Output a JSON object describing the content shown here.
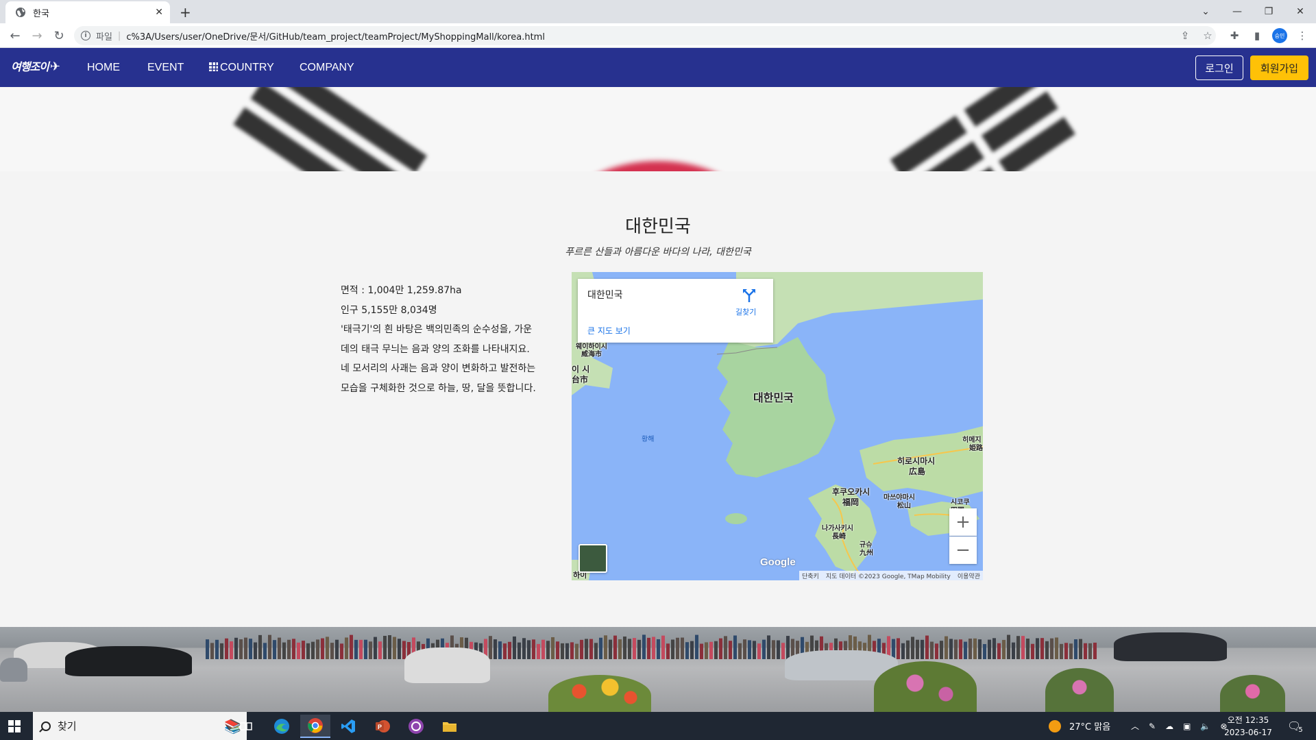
{
  "browser": {
    "tab_title": "한국",
    "address_scheme": "파일",
    "address_url": "c%3A/Users/user/OneDrive/문서/GitHub/team_project/teamProject/MyShoppingMall/korea.html",
    "profile_initials": "승민"
  },
  "nav": {
    "logo": "여행조이",
    "links": [
      "HOME",
      "EVENT",
      "COUNTRY",
      "COMPANY"
    ],
    "login": "로그인",
    "signup": "회원가입"
  },
  "content": {
    "title": "대한민국",
    "subtitle": "푸르른 산들과 아름다운 바다의 나라, 대한민국",
    "area": "면적 : 1,004만 1,259.87ha",
    "population": "인구 5,155만 8,034명",
    "description_lines": [
      "'태극기'의 흰 바탕은 백의민족의 순수성을, 가운",
      "데의 태극 무늬는 음과 양의 조화를 나타내지요.",
      "네 모서리의 사괘는 음과 양이 변화하고 발전하는",
      "모습을 구체화한 것으로 하늘, 땅, 달을 뜻합니다."
    ]
  },
  "map": {
    "place_name": "대한민국",
    "directions": "길찾기",
    "larger_map": "큰 지도 보기",
    "labels": {
      "korea": "대한민국",
      "yellow_sea": "황해",
      "hiroshima": "히로시마시",
      "hiroshima_kanji": "広島",
      "fukuoka": "후쿠오카시",
      "fukuoka_kanji": "福岡",
      "matsuyama": "마쓰야마시",
      "matsuyama_kanji": "松山",
      "nagasaki": "나가사키시",
      "nagasaki_kanji": "長崎",
      "kyushu": "규슈",
      "kyushu_kanji": "九州",
      "weihai": "웨이하이시",
      "weihai_kanji": "威海市",
      "taian": "이 시",
      "taian_kanji": "台市",
      "shikoku": "시코쿠",
      "shikoku_kanji": "四国",
      "himeji": "히메지",
      "himeji_kanji": "姫路",
      "bottom_left": "하이"
    },
    "zoom_in": "+",
    "zoom_out": "−",
    "google": "Google",
    "attrib_shortcuts": "단축키",
    "attrib_data": "지도 데이터 ©2023 Google, TMap Mobility",
    "attrib_terms": "이용약관"
  },
  "taskbar": {
    "search_placeholder": "찾기",
    "weather": "27°C  맑음",
    "time": "오전 12:35",
    "date": "2023-06-17",
    "notif_count": "5"
  },
  "colors": {
    "navbar": "#27318f",
    "signup": "#ffc107",
    "sea": "#8ab4f8",
    "land": "#a8d4a0",
    "taeguk_red": "#d43250"
  }
}
